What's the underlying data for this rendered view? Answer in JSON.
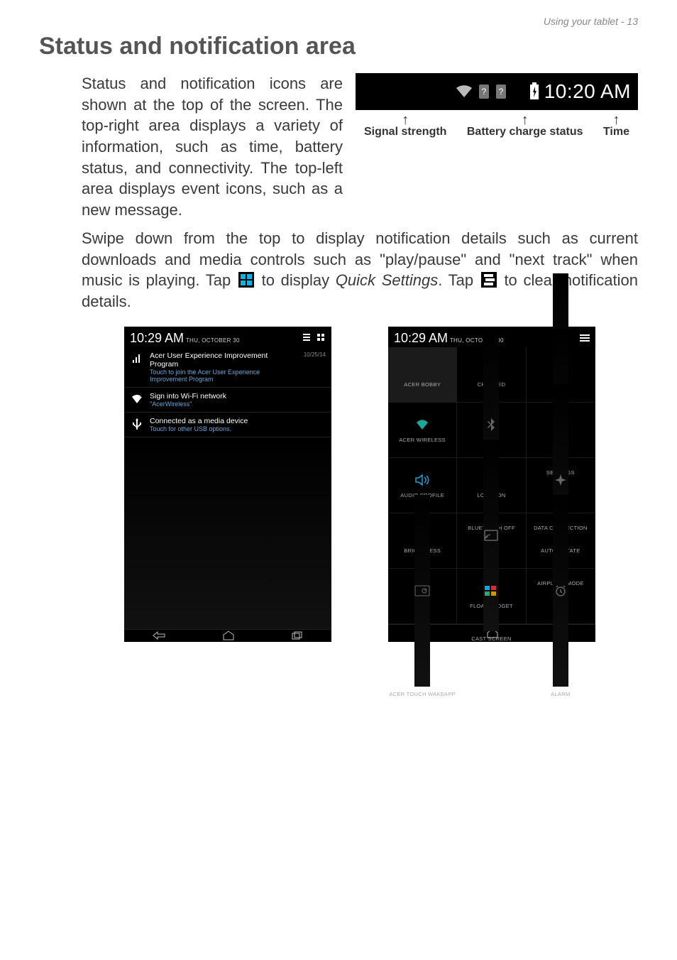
{
  "header": {
    "breadcrumb": "Using your tablet - 13"
  },
  "title": "Status and notification area",
  "para1": "Status and notification icons are shown at the top of the screen. The top-right area displays a variety of information, such as time, battery status, and connectivity. The top-left area displays event icons, such as a new message.",
  "statusbar": {
    "time": "10:20 AM",
    "labels": {
      "signal": "Signal strength",
      "battery": "Battery charge status",
      "time": "Time"
    }
  },
  "para2_a": "Swipe down from the top to display notification details such as current downloads and media controls such as \"play/pause\" and \"next track\" when music is playing. Tap ",
  "para2_b": " to display ",
  "para2_c": "Quick Settings",
  "para2_d": ". Tap ",
  "para2_e": " to clear notification details.",
  "shot1": {
    "time": "10:29 AM",
    "date": "THU, OCTOBER 30",
    "notifs": [
      {
        "icon": "bar-icon",
        "title": "Acer User Experience Improvement Program",
        "sub": "Touch to join the Acer User Experience Improvement Program",
        "date": "10/25/14"
      },
      {
        "icon": "wifi-q-icon",
        "title": "Sign into Wi-Fi network",
        "sub": "\"AcerWireless\"",
        "date": ""
      },
      {
        "icon": "usb-icon",
        "title": "Connected as a media device",
        "sub": "Touch for other USB options.",
        "date": ""
      }
    ]
  },
  "shot2": {
    "time": "10:29 AM",
    "date": "THU, OCTOBER 30",
    "tiles": [
      {
        "label": "ACER BOBBY",
        "icon": "avatar-icon",
        "profile": true
      },
      {
        "label": "CHARGED",
        "icon": "battery-bolt-icon"
      },
      {
        "label": "SETTINGS",
        "icon": "gear-icon",
        "dim": true
      },
      {
        "label": "ACER WIRELESS",
        "icon": "wifi-icon",
        "teal": true
      },
      {
        "label": "BLUETOOTH OFF",
        "icon": "bluetooth-icon",
        "dim": true
      },
      {
        "label": "DATA CONNECTION",
        "icon": "data-icon",
        "dim": true
      },
      {
        "label": "AUDIO PROFILE",
        "icon": "speaker-icon",
        "blue": true
      },
      {
        "label": "LOCATION",
        "icon": "location-icon",
        "teal": true
      },
      {
        "label": "AIRPLANE MODE",
        "icon": "airplane-icon",
        "dim": true
      },
      {
        "label": "BRIGHTNESS",
        "icon": "brightness-icon",
        "teal": true
      },
      {
        "label": "CAST SCREEN",
        "icon": "cast-icon",
        "dim": true
      },
      {
        "label": "AUTO ROTATE",
        "icon": "rotate-icon",
        "teal": true
      },
      {
        "label": "ACER TOUCH WAKEAPP",
        "icon": "touch-icon",
        "dim": true
      },
      {
        "label": "FLOAT GADGET",
        "icon": "float-icon"
      },
      {
        "label": "ALARM",
        "icon": "alarm-icon",
        "dim": true
      }
    ]
  }
}
